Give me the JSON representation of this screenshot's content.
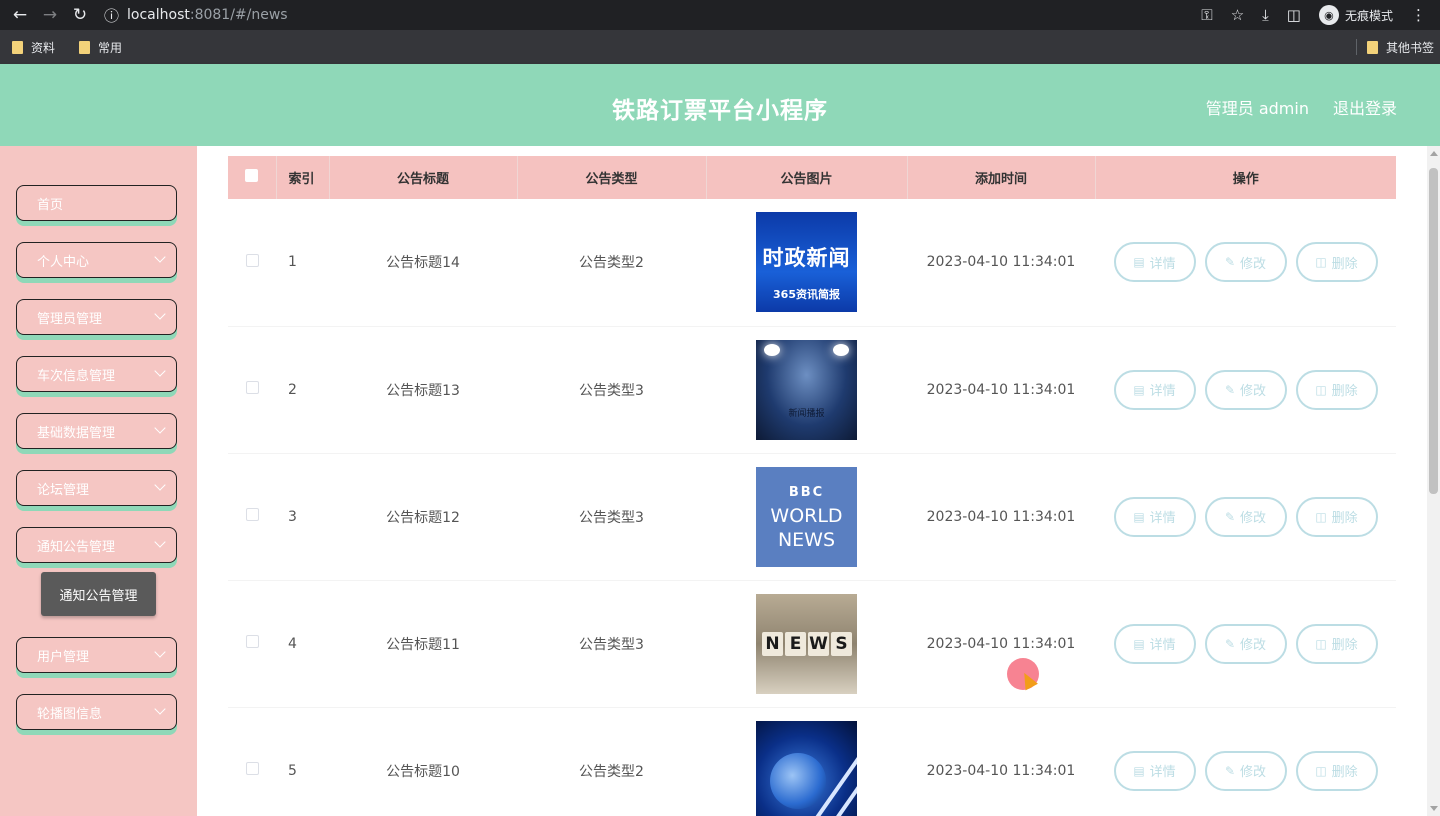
{
  "browser": {
    "url_host": "localhost",
    "url_path": ":8081/#/news",
    "incognito_label": "无痕模式",
    "bookmarks": [
      "资料",
      "常用"
    ],
    "other_bookmarks": "其他书签"
  },
  "header": {
    "title": "铁路订票平台小程序",
    "user_label": "管理员 admin",
    "logout_label": "退出登录"
  },
  "sidebar": {
    "items": [
      {
        "label": "首页",
        "has_chevron": false
      },
      {
        "label": "个人中心",
        "has_chevron": true
      },
      {
        "label": "管理员管理",
        "has_chevron": true
      },
      {
        "label": "车次信息管理",
        "has_chevron": true
      },
      {
        "label": "基础数据管理",
        "has_chevron": true
      },
      {
        "label": "论坛管理",
        "has_chevron": true
      },
      {
        "label": "通知公告管理",
        "has_chevron": true
      },
      {
        "label": "用户管理",
        "has_chevron": true
      },
      {
        "label": "轮播图信息",
        "has_chevron": true
      }
    ],
    "submenu_label": "通知公告管理"
  },
  "table": {
    "columns": [
      "",
      "索引",
      "公告标题",
      "公告类型",
      "公告图片",
      "添加时间",
      "操作"
    ],
    "rows": [
      {
        "index": "1",
        "title": "公告标题14",
        "type": "公告类型2",
        "image": "时政新闻 365资讯简报",
        "time": "2023-04-10 11:34:01"
      },
      {
        "index": "2",
        "title": "公告标题13",
        "type": "公告类型3",
        "image": "新闻播报",
        "time": "2023-04-10 11:34:01"
      },
      {
        "index": "3",
        "title": "公告标题12",
        "type": "公告类型3",
        "image": "BBC WORLD NEWS",
        "time": "2023-04-10 11:34:01"
      },
      {
        "index": "4",
        "title": "公告标题11",
        "type": "公告类型3",
        "image": "NEWS",
        "time": "2023-04-10 11:34:01"
      },
      {
        "index": "5",
        "title": "公告标题10",
        "type": "公告类型2",
        "image": "",
        "time": "2023-04-10 11:34:01"
      }
    ],
    "actions": {
      "detail": "详情",
      "edit": "修改",
      "delete": "删除"
    }
  },
  "thumb_text": {
    "t1_big": "时政新闻",
    "t1_small": "365资讯简报",
    "t2_label": "新闻播报",
    "t3_bbc": "BBC",
    "t3_w1": "WORLD",
    "t3_w2": "NEWS",
    "t4_letters": [
      "N",
      "E",
      "W",
      "S"
    ]
  },
  "colors": {
    "header_bg": "#8fd8b8",
    "sidebar_bg": "#f5c6c3",
    "table_head_bg": "#f5c2c0",
    "action_border": "#bcdde4"
  }
}
